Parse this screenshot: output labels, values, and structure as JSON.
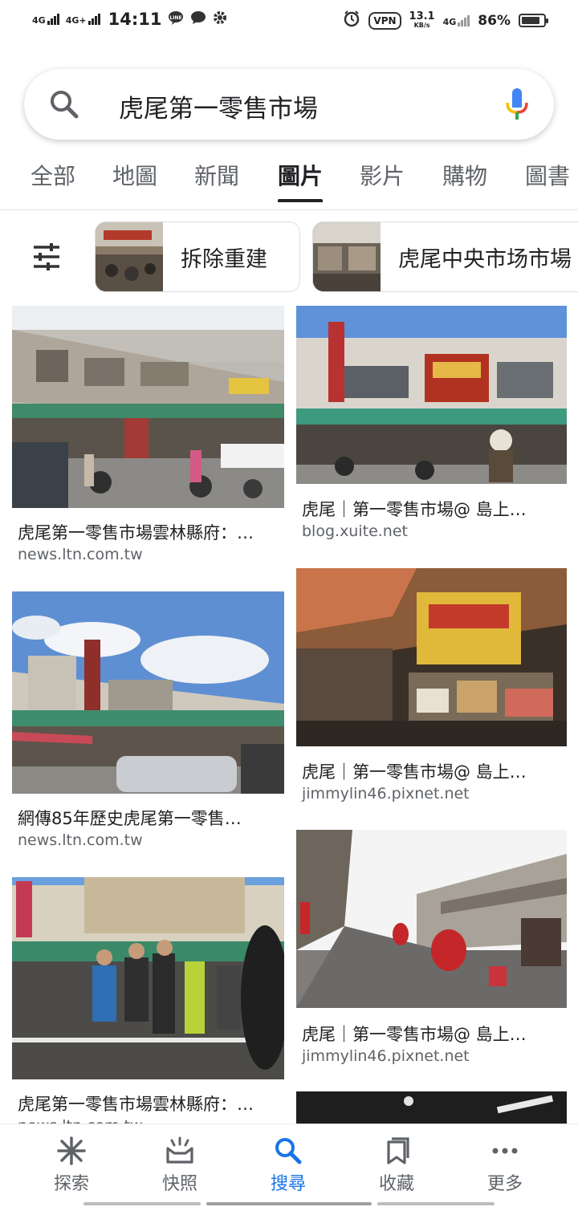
{
  "status_bar": {
    "net1": "4G",
    "net2": "4G+",
    "time": "14:11",
    "vpn": "VPN",
    "speed": "13.1",
    "speed_unit": "KB/s",
    "net3": "4G",
    "battery": "86%",
    "battery_level": 0.86
  },
  "search": {
    "query": "虎尾第一零售市場"
  },
  "tabs": [
    {
      "label": "全部"
    },
    {
      "label": "地圖"
    },
    {
      "label": "新聞"
    },
    {
      "label": "圖片"
    },
    {
      "label": "影片"
    },
    {
      "label": "購物"
    },
    {
      "label": "圖書"
    }
  ],
  "active_tab": "圖片",
  "chips": [
    {
      "label": "拆除重建"
    },
    {
      "label": "虎尾中央市场市場"
    }
  ],
  "results": [
    {
      "caption": "虎尾第一零售市場雲林縣府：…",
      "source": "news.ltn.com.tw"
    },
    {
      "caption": "虎尾｜第一零售市場@ 島上…",
      "source": "blog.xuite.net"
    },
    {
      "caption": "網傳85年歷史虎尾第一零售…",
      "source": "news.ltn.com.tw"
    },
    {
      "caption": "虎尾｜第一零售市場@ 島上…",
      "source": "jimmylin46.pixnet.net"
    },
    {
      "caption": "虎尾第一零售市場雲林縣府：…",
      "source": "news.ltn.com.tw"
    },
    {
      "caption": "虎尾｜第一零售市場@ 島上…",
      "source": "jimmylin46.pixnet.net"
    }
  ],
  "bottom_nav": [
    {
      "label": "探索",
      "icon": "asterisk-icon"
    },
    {
      "label": "快照",
      "icon": "snapshot-tray-icon"
    },
    {
      "label": "搜尋",
      "icon": "search-icon"
    },
    {
      "label": "收藏",
      "icon": "bookmark-icon"
    },
    {
      "label": "更多",
      "icon": "more-dots-icon"
    }
  ],
  "colors": {
    "accent": "#1a73e8",
    "text": "#202124",
    "muted": "#5f6368"
  }
}
